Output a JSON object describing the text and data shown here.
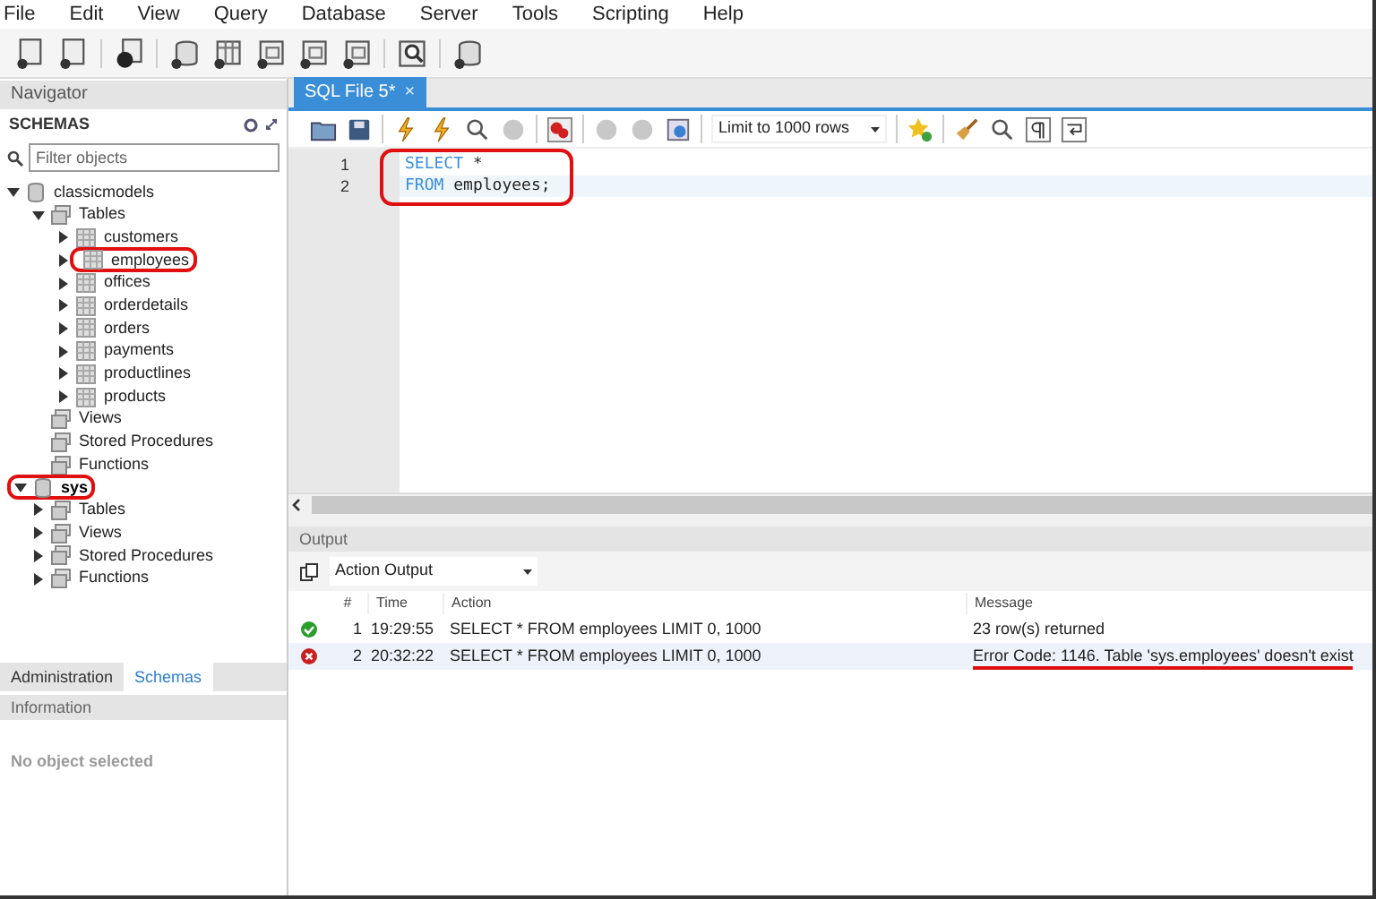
{
  "menu": [
    "File",
    "Edit",
    "View",
    "Query",
    "Database",
    "Server",
    "Tools",
    "Scripting",
    "Help"
  ],
  "navigator": {
    "title": "Navigator",
    "section": "SCHEMAS",
    "filter": {
      "placeholder": "Filter objects"
    },
    "tree": [
      {
        "label": "classicmodels",
        "kind": "schema",
        "expandable": true,
        "expanded": true,
        "default": false,
        "circled": false,
        "children": [
          {
            "label": "Tables",
            "kind": "folder",
            "expandable": true,
            "expanded": true,
            "default": false,
            "circled": false,
            "children": [
              {
                "label": "customers",
                "kind": "table",
                "expandable": true,
                "expanded": false,
                "default": false,
                "circled": false
              },
              {
                "label": "employees",
                "kind": "table",
                "expandable": true,
                "expanded": false,
                "default": false,
                "circled": true
              },
              {
                "label": "offices",
                "kind": "table",
                "expandable": true,
                "expanded": false,
                "default": false,
                "circled": false
              },
              {
                "label": "orderdetails",
                "kind": "table",
                "expandable": true,
                "expanded": false,
                "default": false,
                "circled": false
              },
              {
                "label": "orders",
                "kind": "table",
                "expandable": true,
                "expanded": false,
                "default": false,
                "circled": false
              },
              {
                "label": "payments",
                "kind": "table",
                "expandable": true,
                "expanded": false,
                "default": false,
                "circled": false
              },
              {
                "label": "productlines",
                "kind": "table",
                "expandable": true,
                "expanded": false,
                "default": false,
                "circled": false
              },
              {
                "label": "products",
                "kind": "table",
                "expandable": true,
                "expanded": false,
                "default": false,
                "circled": false
              }
            ]
          },
          {
            "label": "Views",
            "kind": "folder",
            "expandable": false,
            "default": false,
            "circled": false
          },
          {
            "label": "Stored Procedures",
            "kind": "folder",
            "expandable": false,
            "default": false,
            "circled": false
          },
          {
            "label": "Functions",
            "kind": "folder",
            "expandable": false,
            "default": false,
            "circled": false
          }
        ]
      },
      {
        "label": "sys",
        "kind": "schema",
        "expandable": true,
        "expanded": true,
        "default": true,
        "circled": true,
        "children": [
          {
            "label": "Tables",
            "kind": "folder",
            "expandable": true,
            "expanded": false,
            "default": false,
            "circled": false
          },
          {
            "label": "Views",
            "kind": "folder",
            "expandable": true,
            "expanded": false,
            "default": false,
            "circled": false
          },
          {
            "label": "Stored Procedures",
            "kind": "folder",
            "expandable": true,
            "expanded": false,
            "default": false,
            "circled": false
          },
          {
            "label": "Functions",
            "kind": "folder",
            "expandable": true,
            "expanded": false,
            "default": false,
            "circled": false
          }
        ]
      }
    ]
  },
  "bottom_tabs": [
    {
      "label": "Administration",
      "selected": false
    },
    {
      "label": "Schemas",
      "selected": true
    }
  ],
  "information": {
    "title": "Information",
    "text": "No object selected"
  },
  "editor_tab": {
    "title": "SQL File 5*",
    "close": "×"
  },
  "editor": {
    "limit": "Limit to 1000 rows",
    "circled": true,
    "lines": [
      {
        "number": "1",
        "current": false,
        "tokens": [
          {
            "kind": "keyword",
            "text": "SELECT"
          },
          {
            "kind": "plain",
            "text": " *"
          }
        ]
      },
      {
        "number": "2",
        "current": true,
        "tokens": [
          {
            "kind": "keyword",
            "text": "FROM"
          },
          {
            "kind": "plain",
            "text": " employees;"
          }
        ]
      }
    ]
  },
  "output": {
    "title": "Output",
    "view": "Action Output",
    "columns": [
      "#",
      "Time",
      "Action",
      "Message"
    ],
    "rows": [
      {
        "succeeded": true,
        "number": "1",
        "time": "19:29:55",
        "action": "SELECT * FROM employees LIMIT 0, 1000",
        "message": "23 row(s) returned",
        "selected": false,
        "underlined": false
      },
      {
        "succeeded": false,
        "number": "2",
        "time": "20:32:22",
        "action": "SELECT * FROM employees LIMIT 0, 1000",
        "message": "Error Code: 1146. Table 'sys.employees' doesn't exist",
        "selected": true,
        "underlined": true
      }
    ]
  }
}
